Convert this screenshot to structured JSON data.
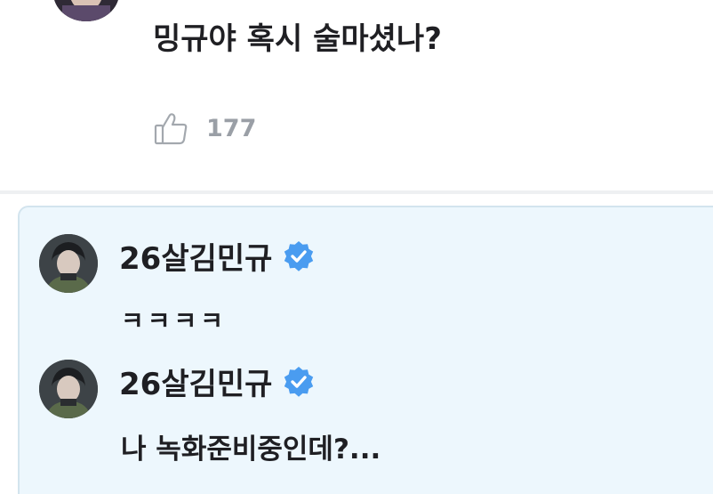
{
  "comment": {
    "text": "밍규야 혹시 술마셨나?",
    "likes": "177",
    "like_icon": "thumbs-up-outline-icon"
  },
  "replies": [
    {
      "author": "26살김민규",
      "verified": true,
      "text": "ㅋㅋㅋㅋ"
    },
    {
      "author": "26살김민규",
      "verified": true,
      "text": "나 녹화준비중인데?..."
    }
  ],
  "colors": {
    "text": "#1f1f23",
    "muted": "#9a9fa6",
    "reply_background": "#edf7fd",
    "reply_border": "#d3e4ee",
    "verified_badge": "#4a9cf0"
  }
}
